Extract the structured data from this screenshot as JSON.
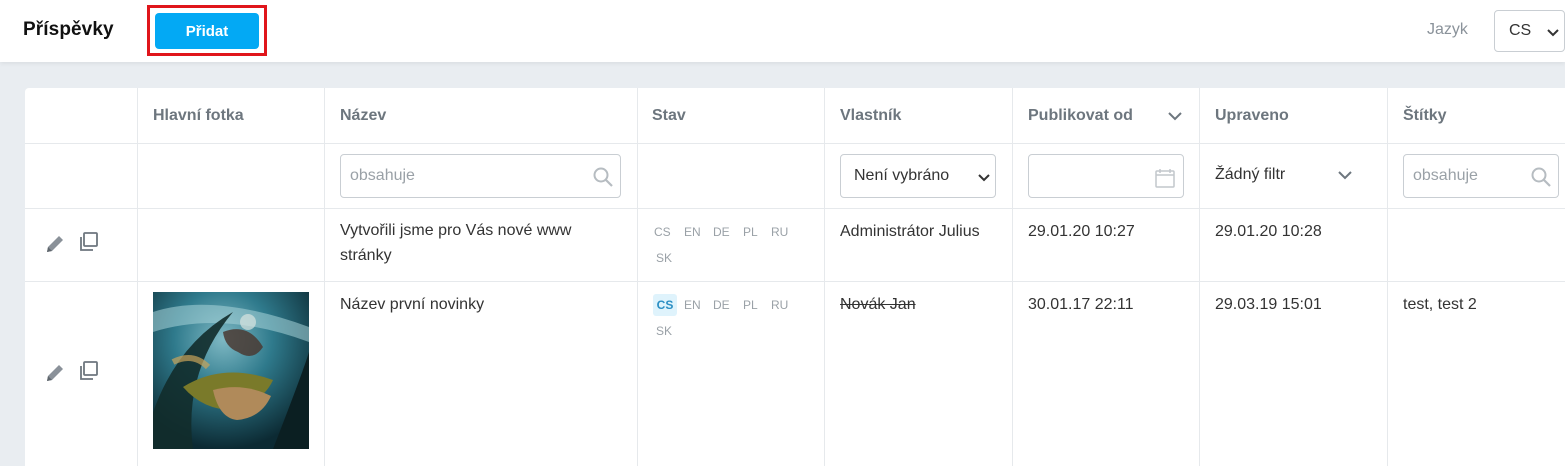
{
  "header": {
    "title": "Příspěvky",
    "add_label": "Přidat",
    "language_label": "Jazyk",
    "language_value": "CS"
  },
  "table": {
    "columns": {
      "photo": "Hlavní fotka",
      "name": "Název",
      "status": "Stav",
      "owner": "Vlastník",
      "publish_from": "Publikovat od",
      "modified": "Upraveno",
      "tags": "Štítky"
    },
    "filters": {
      "name_placeholder": "obsahuje",
      "owner_value": "Není vybráno",
      "modified_value": "Žádný filtr",
      "tags_placeholder": "obsahuje"
    },
    "rows": [
      {
        "name_line1": "Vytvořili jsme pro Vás nové www",
        "name_line2": "stránky",
        "langs": [
          "CS",
          "EN",
          "DE",
          "PL",
          "RU",
          "SK"
        ],
        "owner": "Administrátor Julius",
        "publish_from": "29.01.20 10:27",
        "modified": "29.01.20 10:28",
        "tags": ""
      },
      {
        "name_line1": "Název první novinky",
        "langs": [
          "CS",
          "EN",
          "DE",
          "PL",
          "RU",
          "SK"
        ],
        "owner": "Novák Jan",
        "publish_from": "30.01.17 22:11",
        "modified": "29.03.19 15:01",
        "tags": "test, test 2"
      }
    ]
  },
  "colors": {
    "accent": "#03a9f4",
    "highlight": "#e0151b",
    "active_lang_bg": "#dff3fc"
  },
  "icons": [
    "pencil-icon",
    "duplicate-icon",
    "search-icon",
    "calendar-icon",
    "chevron-down-icon"
  ]
}
